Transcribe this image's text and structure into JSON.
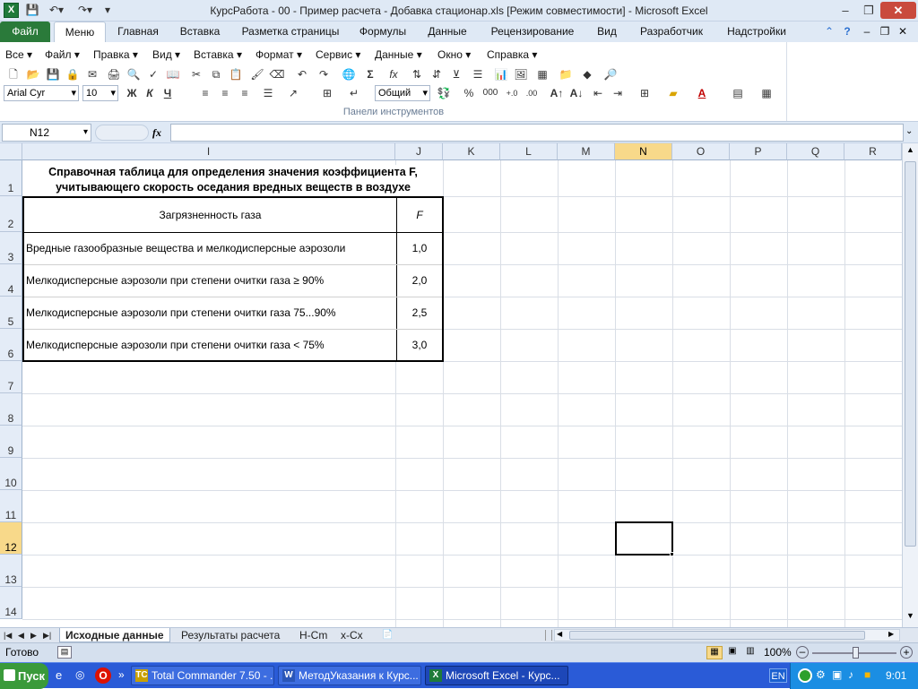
{
  "window": {
    "title": "КурсРабота - 00 - Пример расчета - Добавка стационар.xls  [Режим совместимости]  -  Microsoft Excel",
    "app_icon": "X"
  },
  "ribbon_tabs": [
    "Файл",
    "Меню",
    "Главная",
    "Вставка",
    "Разметка страницы",
    "Формулы",
    "Данные",
    "Рецензирование",
    "Вид",
    "Разработчик",
    "Надстройки"
  ],
  "menu_items": [
    "Все",
    "Файл",
    "Правка",
    "Вид",
    "Вставка",
    "Формат",
    "Сервис",
    "Данные",
    "Окно",
    "Справка"
  ],
  "toolbar": {
    "font_name": "Arial Cyr",
    "font_size": "10",
    "number_format": "Общий",
    "bold": "Ж",
    "italic": "К",
    "underline": "Ч",
    "percent": "%",
    "thousands": "000",
    "sum": "Σ",
    "fx": "fx",
    "group_label": "Панели инструментов"
  },
  "formula_bar": {
    "cell_ref": "N12",
    "fx_label": "fx",
    "content": ""
  },
  "columns": [
    "I",
    "J",
    "K",
    "L",
    "M",
    "N",
    "O",
    "P",
    "Q",
    "R"
  ],
  "rows": [
    "1",
    "2",
    "3",
    "4",
    "5",
    "6",
    "7",
    "8",
    "9",
    "10",
    "11",
    "12",
    "13",
    "14"
  ],
  "selected": {
    "column": "N",
    "row": "12"
  },
  "table": {
    "title_line1": "Справочная таблица для определения значения коэффициента F,",
    "title_line2": "учитывающего скорость оседания вредных веществ в воздухе",
    "header_gas": "Загрязненность газа",
    "header_f": "F",
    "rows": [
      {
        "label": "Вредные газообразные вещества и мелкодисперсные аэрозоли",
        "value": "1,0"
      },
      {
        "label": "Мелкодисперсные аэрозоли при степени очитки газа ≥ 90%",
        "value": "2,0"
      },
      {
        "label": "Мелкодисперсные аэрозоли при степени очитки газа 75...90%",
        "value": "2,5"
      },
      {
        "label": "Мелкодисперсные аэрозоли при степени очитки газа < 75%",
        "value": "3,0"
      }
    ]
  },
  "sheet_tabs": [
    "Исходные данные",
    "Результаты расчета",
    "H-Cm",
    "x-Cx"
  ],
  "status": {
    "ready": "Готово",
    "zoom": "100%"
  },
  "taskbar": {
    "start": "Пуск",
    "tasks": [
      {
        "label": "Total Commander 7.50 - ...",
        "icon": "TC"
      },
      {
        "label": "МетодУказания к Курс...",
        "icon": "W"
      },
      {
        "label": "Microsoft Excel - Курс...",
        "icon": "X"
      }
    ],
    "lang": "EN",
    "clock": "9:01"
  }
}
